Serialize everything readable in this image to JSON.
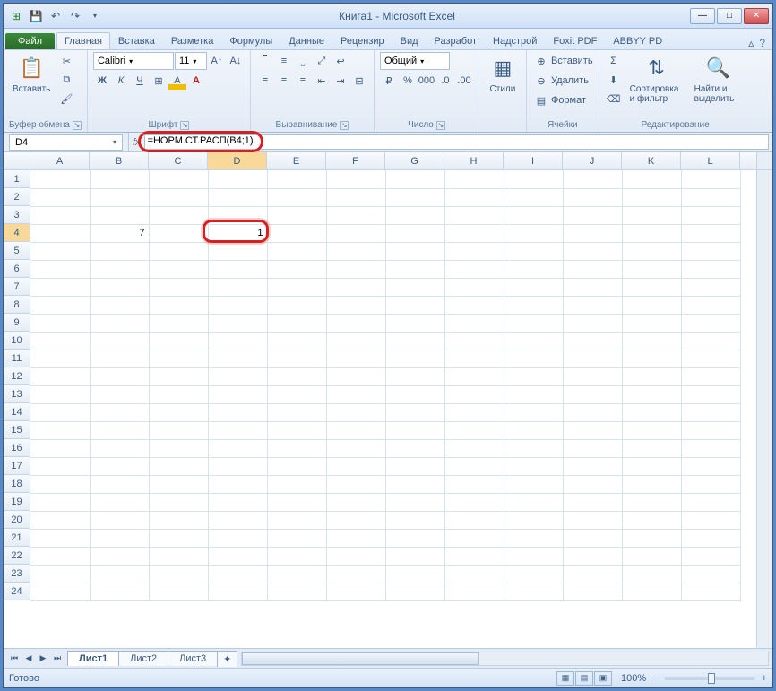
{
  "title": "Книга1 - Microsoft Excel",
  "tabs": {
    "file": "Файл",
    "items": [
      "Главная",
      "Вставка",
      "Разметка",
      "Формулы",
      "Данные",
      "Рецензир",
      "Вид",
      "Разработ",
      "Надстрой",
      "Foxit PDF",
      "ABBYY PD"
    ],
    "active": 0
  },
  "ribbon": {
    "clipboard": {
      "label": "Буфер обмена",
      "paste": "Вставить"
    },
    "font": {
      "label": "Шрифт",
      "name": "Calibri",
      "size": "11"
    },
    "align": {
      "label": "Выравнивание"
    },
    "number": {
      "label": "Число",
      "format": "Общий"
    },
    "styles": {
      "label": "Стили",
      "btn": "Стили"
    },
    "cells": {
      "label": "Ячейки",
      "insert": "Вставить",
      "delete": "Удалить",
      "format": "Формат"
    },
    "editing": {
      "label": "Редактирование",
      "sort": "Сортировка и фильтр",
      "find": "Найти и выделить"
    }
  },
  "namebox": "D4",
  "formula": "=НОРМ.СТ.РАСП(B4;1)",
  "columns": [
    "A",
    "B",
    "C",
    "D",
    "E",
    "F",
    "G",
    "H",
    "I",
    "J",
    "K",
    "L"
  ],
  "rows": 24,
  "selected": {
    "col": "D",
    "row": 4,
    "colIndex": 3
  },
  "cells": {
    "B4": "7",
    "D4": "1"
  },
  "sheets": {
    "items": [
      "Лист1",
      "Лист2",
      "Лист3"
    ],
    "active": 0
  },
  "status": {
    "ready": "Готово",
    "zoom": "100%"
  }
}
